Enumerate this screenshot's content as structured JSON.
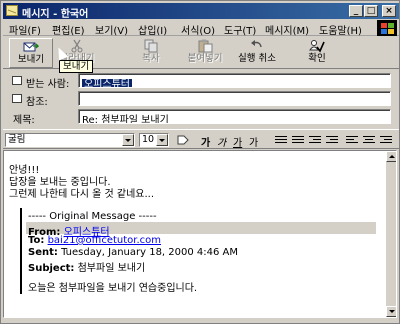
{
  "window": {
    "title": "메시지 - 한국어",
    "controls": {
      "minimize": "_",
      "maximize": "□",
      "close": "×"
    }
  },
  "menu": {
    "items": [
      "파일(F)",
      "편집(E)",
      "보기(V)",
      "삽입(I)",
      "서식(O)",
      "도구(T)",
      "메시지(M)",
      "도움말(H)"
    ]
  },
  "toolbar": {
    "send": {
      "label": "보내기",
      "icon": "send-icon"
    },
    "cut": {
      "label": "잘라내기",
      "icon": "scissors-icon"
    },
    "copy": {
      "label": "복사",
      "icon": "copy-icon"
    },
    "paste": {
      "label": "붙여넣기",
      "icon": "paste-icon"
    },
    "undo": {
      "label": "실행 취소",
      "icon": "undo-icon"
    },
    "check": {
      "label": "확인",
      "icon": "check-names-icon"
    },
    "tooltip": "보내기"
  },
  "fields": {
    "to_label": "받는 사람:",
    "to_value": "오피스튜터",
    "cc_label": "참조:",
    "cc_value": "",
    "subject_label": "제목:",
    "subject_value": "Re: 첨부파일 보내기"
  },
  "format": {
    "font": "굴림",
    "size": "10",
    "bold": "가",
    "italic": "가",
    "underline": "가",
    "color": "가"
  },
  "body": {
    "lines": [
      "안녕!!!",
      "답장을 보내는 중입니다.",
      "그런제 나한테 다시 올 것 같네요..."
    ],
    "quote_header": "----- Original Message -----",
    "from_key": "From:",
    "from_value": "오피스튜터",
    "to_key": "To:",
    "to_value": "bai21@officetutor.com",
    "sent_key": "Sent:",
    "sent_value": "Tuesday, January 18, 2000 4:46 AM",
    "subject_key": "Subject:",
    "subject_value": "첨부파일 보내기",
    "quote_body": "오늘은 첨부파일을 보내기 연습중입니다."
  },
  "colors": {
    "title_start": "#0a246a",
    "title_end": "#3a6ea5",
    "link": "#0000ee",
    "chrome": "#d4d0c8"
  }
}
